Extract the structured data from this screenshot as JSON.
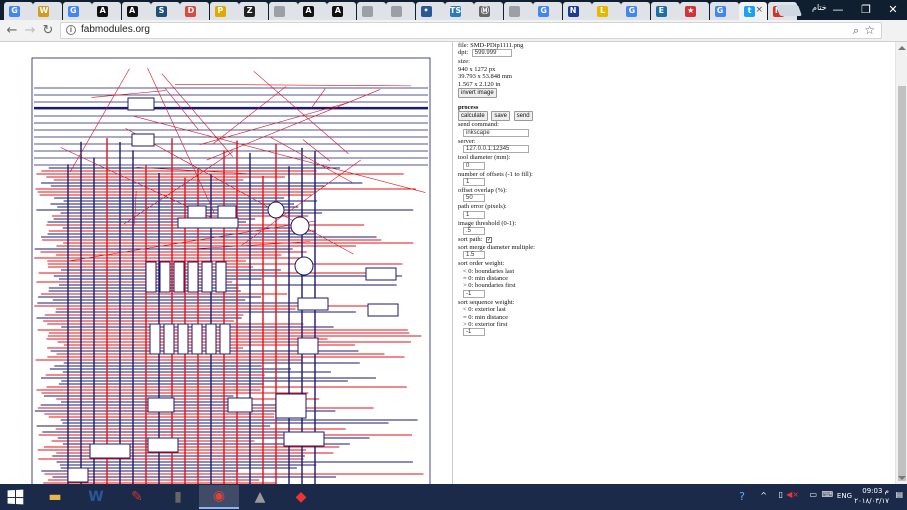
{
  "browser": {
    "tabs": [
      {
        "fav": "G",
        "color": "#4285f4",
        "text": "×"
      },
      {
        "fav": "W",
        "color": "#d79a1c",
        "text": "×"
      },
      {
        "fav": "G",
        "color": "#4285f4",
        "text": "×"
      },
      {
        "fav": "A",
        "color": "#111111",
        "text": "×"
      },
      {
        "fav": "A",
        "color": "#111111",
        "text": "×"
      },
      {
        "fav": "S",
        "color": "#1f4e79",
        "text": "×"
      },
      {
        "fav": "D",
        "color": "#d84b3c",
        "text": "×"
      },
      {
        "fav": "P",
        "color": "#e0a800",
        "text": "×"
      },
      {
        "fav": "Z",
        "color": "#222222",
        "text": "×"
      },
      {
        "fav": "",
        "color": "#9aa0a6",
        "text": "×"
      },
      {
        "fav": "A",
        "color": "#111111",
        "text": "×"
      },
      {
        "fav": "A",
        "color": "#111111",
        "text": "×"
      },
      {
        "fav": "",
        "color": "#9aa0a6",
        "text": "×"
      },
      {
        "fav": "",
        "color": "#9aa0a6",
        "text": "×"
      },
      {
        "fav": "•",
        "color": "#2b5797",
        "text": "×"
      },
      {
        "fav": "TS",
        "color": "#2a7ab8",
        "text": "×"
      },
      {
        "fav": "Ⓜ",
        "color": "#666666",
        "text": "×"
      },
      {
        "fav": "",
        "color": "#9aa0a6",
        "text": "×"
      },
      {
        "fav": "G",
        "color": "#4285f4",
        "text": "×"
      },
      {
        "fav": "N",
        "color": "#1b3d8f",
        "text": "×"
      },
      {
        "fav": "L",
        "color": "#e6b800",
        "text": "×"
      },
      {
        "fav": "G",
        "color": "#4285f4",
        "text": "×"
      },
      {
        "fav": "E",
        "color": "#1d6fa5",
        "text": "×"
      },
      {
        "fav": "★",
        "color": "#d13438",
        "text": "×"
      },
      {
        "fav": "G",
        "color": "#4285f4",
        "text": "×"
      },
      {
        "fav": "t",
        "color": "#1da1f2",
        "text": "×"
      },
      {
        "fav": "M",
        "color": "#d93025",
        "text": "×"
      }
    ],
    "profile_name": "ختام",
    "window_controls": {
      "minimize": "—",
      "maximize": "❐",
      "close": "✕"
    },
    "url": "fabmodules.org"
  },
  "controls": {
    "file_line": "file: SMD-PDip1111.png",
    "dpi_label": "dpi:",
    "dpi_value": "599.999",
    "size_label": "size:",
    "size_px": "940 x 1272 px",
    "size_mm": "39.793 x 53.848 mm",
    "size_in": "1.567 x 2.120 in",
    "invert_button": "invert image",
    "process_heading": "process",
    "calculate_button": "calculate",
    "save_button": "save",
    "send_button": "send",
    "send_command_label": "send command:",
    "send_command_value": "inkscape",
    "server_label": "server:",
    "server_value": "127.0.0.1:12345",
    "tool_diameter_label": "tool diameter (mm):",
    "tool_diameter_value": "0",
    "offsets_label": "number of offsets (-1 to fill):",
    "offsets_value": "1",
    "overlap_label": "offset overlap (%):",
    "overlap_value": "50",
    "path_error_label": "path error (pixels):",
    "path_error_value": "1",
    "threshold_label": "image threshold (0-1):",
    "threshold_value": ".5",
    "sort_path_label": "sort path:",
    "sort_path_checked": "✓",
    "sort_merge_label": "sort merge diameter multiple:",
    "sort_merge_value": "1.5",
    "sort_order_label": "sort order weight:",
    "sort_order_lt0": "< 0: boundaries last",
    "sort_order_eq0": "= 0: min distance",
    "sort_order_gt0": "> 0: boundaries first",
    "sort_order_value": "-1",
    "sort_seq_label": "sort sequence weight:",
    "sort_seq_lt0": "< 0: exterior last",
    "sort_seq_eq0": "= 0: min distance",
    "sort_seq_gt0": "> 0: exterior first",
    "sort_seq_value": "-1"
  },
  "taskbar": {
    "apps": [
      {
        "name": "file-explorer-icon",
        "glyph": "▬",
        "color": "#e8b94a"
      },
      {
        "name": "word-icon",
        "glyph": "W",
        "color": "#2b579a"
      },
      {
        "name": "paint-icon",
        "glyph": "✎",
        "color": "#cc3333"
      },
      {
        "name": "book-app-icon",
        "glyph": "▮",
        "color": "#666666"
      },
      {
        "name": "chrome-icon",
        "glyph": "◉",
        "color": "#db4437"
      },
      {
        "name": "inkscape-icon",
        "glyph": "▲",
        "color": "#999999"
      },
      {
        "name": "fab-app-icon",
        "glyph": "◆",
        "color": "#e33"
      }
    ],
    "lang": "ENG",
    "time": "09:03 م",
    "date": "٢٠١٨/٠٣/١٧"
  },
  "colors": {
    "toolpath_red": "#e0101a",
    "trace_navy": "#1a1a6e",
    "tab_bar": "#0f1f2f",
    "taskbar": "#1c2a4a"
  }
}
